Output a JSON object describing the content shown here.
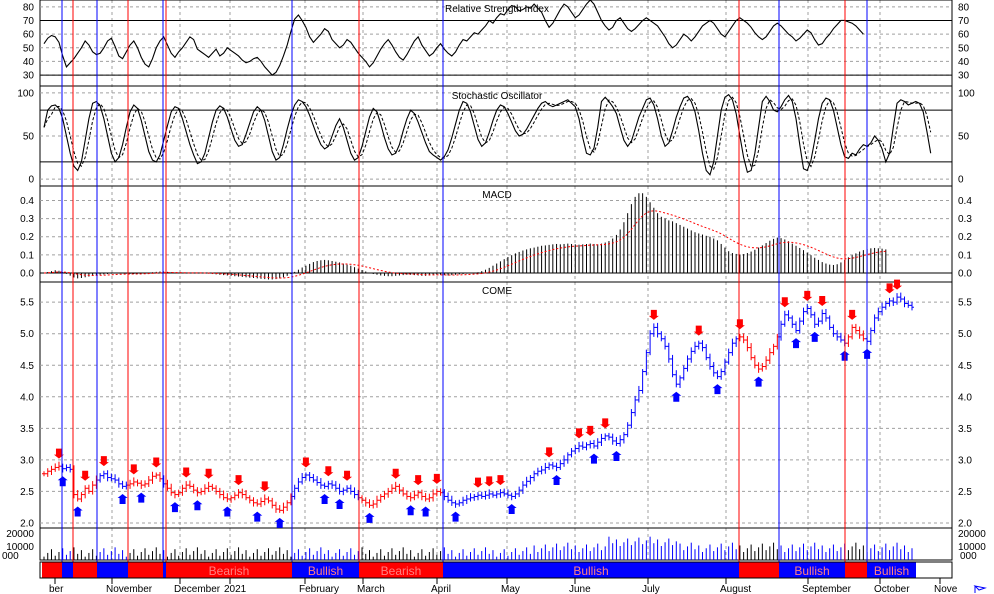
{
  "chart_data": {
    "type": "line",
    "colors": {
      "up": "#0000ff",
      "down": "#ff0000",
      "line": "#000000",
      "bull_band": "#0000ff",
      "bear_band": "#ff0000",
      "grid": "#a0a0a0"
    },
    "months": [
      "ber",
      "November",
      "December",
      "2021",
      "February",
      "March",
      "April",
      "May",
      "June",
      "July",
      "August",
      "September",
      "October",
      "Nove"
    ],
    "volume_axis_labels": [
      "000",
      "000"
    ],
    "panels": {
      "rsi": {
        "title": "Relative Strength Index",
        "ylim": [
          22,
          85
        ],
        "ticks": [
          30,
          40,
          50,
          60,
          70,
          80
        ],
        "levels": [
          30,
          70
        ],
        "values": [
          53,
          57,
          59,
          58,
          54,
          44,
          36,
          39,
          42,
          46,
          50,
          55,
          52,
          47,
          45,
          46,
          50,
          55,
          57,
          51,
          44,
          42,
          47,
          52,
          55,
          50,
          43,
          38,
          36,
          42,
          50,
          55,
          58,
          52,
          46,
          43,
          47,
          50,
          54,
          58,
          56,
          49,
          47,
          45,
          43,
          46,
          49,
          44,
          46,
          50,
          48,
          46,
          44,
          41,
          39,
          40,
          42,
          43,
          40,
          36,
          33,
          30,
          32,
          37,
          44,
          52,
          62,
          71,
          74,
          70,
          65,
          58,
          54,
          57,
          60,
          64,
          62,
          56,
          53,
          50,
          52,
          56,
          54,
          50,
          46,
          43,
          40,
          36,
          39,
          44,
          49,
          53,
          56,
          52,
          47,
          43,
          41,
          45,
          50,
          55,
          58,
          52,
          48,
          44,
          46,
          50,
          53,
          49,
          46,
          44,
          47,
          52,
          56,
          55,
          58,
          61,
          60,
          63,
          66,
          70,
          68,
          72,
          75,
          74,
          78,
          81,
          80,
          77,
          78,
          80,
          79,
          82,
          79,
          76,
          70,
          65,
          68,
          73,
          78,
          82,
          80,
          76,
          72,
          74,
          78,
          82,
          85,
          82,
          76,
          70,
          66,
          63,
          65,
          70,
          72,
          68,
          64,
          62,
          64,
          67,
          70,
          72,
          70,
          68,
          66,
          62,
          58,
          53,
          50,
          52,
          56,
          60,
          58,
          55,
          58,
          62,
          66,
          68,
          70,
          68,
          64,
          60,
          58,
          62,
          66,
          70,
          72,
          70,
          68,
          65,
          61,
          58,
          56,
          58,
          62,
          66,
          68,
          66,
          63,
          60,
          58,
          55,
          57,
          60,
          63,
          61,
          56,
          52,
          53,
          57,
          60,
          64,
          67,
          70,
          70,
          69,
          68,
          66,
          63,
          60
        ]
      },
      "stoch": {
        "title": "Stochastic Oscillator",
        "ylim": [
          -8,
          108
        ],
        "ticks": [
          0,
          50,
          100
        ],
        "levels": [
          20,
          80
        ],
        "k": [
          60,
          80,
          85,
          86,
          82,
          70,
          50,
          30,
          15,
          10,
          20,
          45,
          70,
          88,
          90,
          85,
          70,
          50,
          30,
          20,
          25,
          40,
          60,
          78,
          86,
          82,
          68,
          50,
          32,
          22,
          20,
          28,
          45,
          62,
          78,
          84,
          82,
          70,
          55,
          40,
          28,
          18,
          20,
          30,
          48,
          66,
          80,
          85,
          82,
          72,
          58,
          45,
          38,
          40,
          52,
          65,
          78,
          84,
          80,
          68,
          50,
          32,
          22,
          25,
          40,
          58,
          74,
          86,
          92,
          90,
          84,
          74,
          62,
          50,
          40,
          35,
          38,
          50,
          62,
          70,
          60,
          45,
          30,
          22,
          25,
          38,
          55,
          72,
          82,
          78,
          64,
          48,
          35,
          28,
          30,
          40,
          56,
          70,
          80,
          76,
          66,
          54,
          42,
          32,
          28,
          25,
          22,
          26,
          34,
          48,
          64,
          80,
          90,
          88,
          78,
          62,
          46,
          38,
          42,
          54,
          68,
          80,
          86,
          84,
          76,
          66,
          56,
          50,
          52,
          58,
          66,
          74,
          82,
          88,
          90,
          86,
          84,
          86,
          88,
          90,
          92,
          88,
          84,
          70,
          48,
          30,
          28,
          36,
          60,
          90,
          95,
          90,
          84,
          76,
          60,
          45,
          38,
          44,
          58,
          72,
          82,
          92,
          94,
          86,
          70,
          50,
          38,
          42,
          56,
          72,
          84,
          94,
          96,
          90,
          78,
          56,
          30,
          10,
          5,
          20,
          50,
          80,
          95,
          98,
          92,
          76,
          50,
          25,
          8,
          10,
          30,
          60,
          90,
          96,
          90,
          80,
          78,
          84,
          92,
          97,
          90,
          70,
          40,
          12,
          10,
          22,
          45,
          70,
          88,
          94,
          92,
          80,
          60,
          40,
          26,
          24,
          30,
          28,
          35,
          40,
          38,
          42,
          50,
          45,
          35,
          20,
          30,
          60,
          88,
          92,
          90,
          86,
          88,
          90,
          88,
          78,
          55,
          30
        ]
      },
      "macd": {
        "title": "MACD",
        "ylim": [
          -0.05,
          0.48
        ],
        "ticks": [
          0.0,
          0.1,
          0.2,
          0.3,
          0.4
        ],
        "values": [
          0.0,
          0.005,
          0.01,
          0.015,
          0.012,
          0.005,
          -0.005,
          -0.015,
          -0.025,
          -0.03,
          -0.028,
          -0.024,
          -0.02,
          -0.016,
          -0.012,
          -0.01,
          -0.008,
          -0.006,
          -0.004,
          -0.002,
          0.0,
          -0.002,
          -0.004,
          -0.005,
          -0.006,
          -0.004,
          -0.002,
          0.0,
          0.002,
          0.004,
          0.006,
          0.008,
          0.008,
          0.006,
          0.004,
          0.002,
          0.0,
          -0.002,
          -0.003,
          -0.002,
          -0.001,
          0.0,
          0.0,
          -0.002,
          -0.004,
          -0.006,
          -0.008,
          -0.01,
          -0.012,
          -0.014,
          -0.016,
          -0.018,
          -0.02,
          -0.022,
          -0.024,
          -0.026,
          -0.028,
          -0.03,
          -0.032,
          -0.034,
          -0.036,
          -0.036,
          -0.034,
          -0.03,
          -0.024,
          -0.016,
          -0.006,
          0.006,
          0.018,
          0.03,
          0.04,
          0.05,
          0.06,
          0.066,
          0.07,
          0.072,
          0.07,
          0.066,
          0.062,
          0.058,
          0.052,
          0.046,
          0.04,
          0.032,
          0.024,
          0.016,
          0.008,
          0.0,
          -0.006,
          -0.01,
          -0.014,
          -0.016,
          -0.018,
          -0.018,
          -0.016,
          -0.014,
          -0.012,
          -0.01,
          -0.01,
          -0.012,
          -0.014,
          -0.016,
          -0.016,
          -0.014,
          -0.012,
          -0.01,
          -0.01,
          -0.012,
          -0.014,
          -0.012,
          -0.01,
          -0.008,
          -0.006,
          -0.004,
          -0.002,
          0.0,
          0.004,
          0.01,
          0.018,
          0.028,
          0.04,
          0.052,
          0.064,
          0.076,
          0.088,
          0.098,
          0.108,
          0.116,
          0.124,
          0.13,
          0.136,
          0.14,
          0.145,
          0.15,
          0.152,
          0.155,
          0.158,
          0.16,
          0.158,
          0.16,
          0.162,
          0.16,
          0.158,
          0.156,
          0.158,
          0.16,
          0.162,
          0.16,
          0.158,
          0.162,
          0.168,
          0.176,
          0.19,
          0.21,
          0.24,
          0.28,
          0.33,
          0.38,
          0.42,
          0.44,
          0.44,
          0.42,
          0.39,
          0.36,
          0.33,
          0.31,
          0.3,
          0.29,
          0.285,
          0.275,
          0.265,
          0.255,
          0.245,
          0.235,
          0.225,
          0.218,
          0.212,
          0.205,
          0.2,
          0.19,
          0.18,
          0.16,
          0.14,
          0.12,
          0.11,
          0.105,
          0.102,
          0.104,
          0.11,
          0.118,
          0.128,
          0.14,
          0.152,
          0.165,
          0.178,
          0.188,
          0.195,
          0.192,
          0.185,
          0.175,
          0.162,
          0.15,
          0.138,
          0.126,
          0.112,
          0.098,
          0.084,
          0.072,
          0.06,
          0.052,
          0.046,
          0.044,
          0.048,
          0.058,
          0.072,
          0.086,
          0.098,
          0.108,
          0.118,
          0.126,
          0.132,
          0.136,
          0.138,
          0.136,
          0.134,
          0.13
        ]
      },
      "price": {
        "title": "COME",
        "ylim": [
          1.92,
          5.82
        ],
        "ticks": [
          2.0,
          2.5,
          3.0,
          3.5,
          4.0,
          4.5,
          5.0,
          5.5
        ],
        "close": [
          2.78,
          2.82,
          2.85,
          2.88,
          2.9,
          2.86,
          2.88,
          2.85,
          2.45,
          2.38,
          2.45,
          2.55,
          2.5,
          2.6,
          2.68,
          2.75,
          2.78,
          2.72,
          2.7,
          2.68,
          2.62,
          2.58,
          2.6,
          2.62,
          2.65,
          2.63,
          2.6,
          2.62,
          2.68,
          2.74,
          2.76,
          2.7,
          2.62,
          2.55,
          2.48,
          2.45,
          2.48,
          2.55,
          2.6,
          2.58,
          2.52,
          2.48,
          2.5,
          2.55,
          2.58,
          2.55,
          2.5,
          2.45,
          2.4,
          2.38,
          2.4,
          2.44,
          2.48,
          2.45,
          2.4,
          2.36,
          2.32,
          2.3,
          2.34,
          2.38,
          2.35,
          2.28,
          2.22,
          2.2,
          2.25,
          2.32,
          2.42,
          2.55,
          2.65,
          2.72,
          2.76,
          2.72,
          2.68,
          2.64,
          2.6,
          2.58,
          2.62,
          2.6,
          2.55,
          2.5,
          2.52,
          2.55,
          2.5,
          2.45,
          2.4,
          2.36,
          2.32,
          2.28,
          2.3,
          2.36,
          2.42,
          2.46,
          2.5,
          2.55,
          2.58,
          2.52,
          2.46,
          2.42,
          2.4,
          2.44,
          2.48,
          2.42,
          2.38,
          2.4,
          2.46,
          2.5,
          2.48,
          2.42,
          2.36,
          2.32,
          2.3,
          2.32,
          2.36,
          2.38,
          2.4,
          2.42,
          2.44,
          2.42,
          2.44,
          2.46,
          2.44,
          2.46,
          2.48,
          2.46,
          2.44,
          2.42,
          2.46,
          2.52,
          2.6,
          2.66,
          2.72,
          2.78,
          2.82,
          2.84,
          2.88,
          2.92,
          2.9,
          2.88,
          2.94,
          3.0,
          3.08,
          3.14,
          3.18,
          3.22,
          3.2,
          3.24,
          3.26,
          3.22,
          3.28,
          3.34,
          3.38,
          3.36,
          3.3,
          3.26,
          3.32,
          3.4,
          3.55,
          3.75,
          3.95,
          4.1,
          4.4,
          4.7,
          5.0,
          5.1,
          5.0,
          4.92,
          4.8,
          4.6,
          4.35,
          4.2,
          4.3,
          4.45,
          4.6,
          4.72,
          4.8,
          4.85,
          4.78,
          4.62,
          4.48,
          4.38,
          4.32,
          4.4,
          4.55,
          4.7,
          4.85,
          4.92,
          4.95,
          4.9,
          4.78,
          4.62,
          4.5,
          4.44,
          4.48,
          4.58,
          4.7,
          4.8,
          4.95,
          5.15,
          5.3,
          5.25,
          5.15,
          5.05,
          5.2,
          5.35,
          5.4,
          5.3,
          5.15,
          5.2,
          5.32,
          5.25,
          5.1,
          5.0,
          4.95,
          4.9,
          4.85,
          4.95,
          5.1,
          5.05,
          4.98,
          4.92,
          4.88,
          5.05,
          5.25,
          5.35,
          5.42,
          5.48,
          5.52,
          5.5,
          5.58,
          5.55,
          5.48,
          5.45,
          5.42
        ]
      },
      "volume": {
        "ylim": [
          0,
          24000
        ],
        "ticks": [
          10000,
          20000
        ]
      }
    },
    "vertical_lines": {
      "blue": [
        62,
        97,
        163,
        292,
        443,
        779,
        867
      ],
      "red": [
        73,
        128,
        166,
        359,
        739,
        845
      ]
    },
    "bands": [
      {
        "x0": 42,
        "x1": 62,
        "color": "#ff0000",
        "label": ""
      },
      {
        "x0": 62,
        "x1": 73,
        "color": "#0000ff",
        "label": ""
      },
      {
        "x0": 73,
        "x1": 97,
        "color": "#ff0000",
        "label": ""
      },
      {
        "x0": 97,
        "x1": 128,
        "color": "#0000ff",
        "label": ""
      },
      {
        "x0": 128,
        "x1": 163,
        "color": "#ff0000",
        "label": ""
      },
      {
        "x0": 163,
        "x1": 166,
        "color": "#0000ff",
        "label": ""
      },
      {
        "x0": 166,
        "x1": 292,
        "color": "#ff0000",
        "label": "Bearish"
      },
      {
        "x0": 292,
        "x1": 359,
        "color": "#0000ff",
        "label": "Bullish"
      },
      {
        "x0": 359,
        "x1": 443,
        "color": "#ff0000",
        "label": "Bearish"
      },
      {
        "x0": 443,
        "x1": 739,
        "color": "#0000ff",
        "label": "Bullish"
      },
      {
        "x0": 739,
        "x1": 779,
        "color": "#ff0000",
        "label": ""
      },
      {
        "x0": 779,
        "x1": 845,
        "color": "#0000ff",
        "label": "Bullish"
      },
      {
        "x0": 845,
        "x1": 867,
        "color": "#ff0000",
        "label": ""
      },
      {
        "x0": 867,
        "x1": 916,
        "color": "#0000ff",
        "label": "Bullish"
      }
    ]
  }
}
